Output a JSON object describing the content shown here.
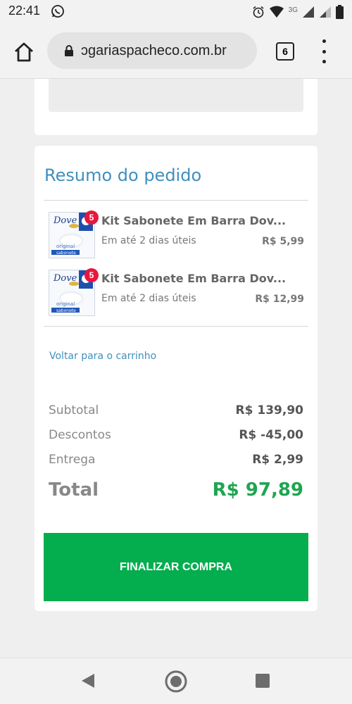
{
  "status_bar": {
    "time": "22:41",
    "network": "3G"
  },
  "browser": {
    "url": "ɔgariaspacheco.com.br",
    "tab_count": "6"
  },
  "summary": {
    "title": "Resumo do pedido",
    "items": [
      {
        "name": "Kit Sabonete Em Barra Dov...",
        "delivery": "Em até 2 dias úteis",
        "price": "R$ 5,99",
        "badge": "5",
        "thumb_brand": "Dove",
        "thumb_text_1": "original",
        "thumb_text_2": "sabonete"
      },
      {
        "name": "Kit Sabonete Em Barra Dov...",
        "delivery": "Em até 2 dias úteis",
        "price": "R$ 12,99",
        "badge": "5",
        "thumb_brand": "Dove",
        "thumb_text_1": "original",
        "thumb_text_2": "sabonete"
      }
    ],
    "back_link": "Voltar para o carrinho",
    "subtotal_label": "Subtotal",
    "subtotal_value": "R$ 139,90",
    "discounts_label": "Descontos",
    "discounts_value": "R$ -45,00",
    "delivery_label": "Entrega",
    "delivery_value": "R$ 2,99",
    "total_label": "Total",
    "total_value": "R$ 97,89",
    "checkout_label": "FINALIZAR COMPRA"
  },
  "colors": {
    "accent_blue": "#3f8fbf",
    "total_green": "#1fa551",
    "button_green": "#04ad4d",
    "badge_red": "#e8163e"
  }
}
